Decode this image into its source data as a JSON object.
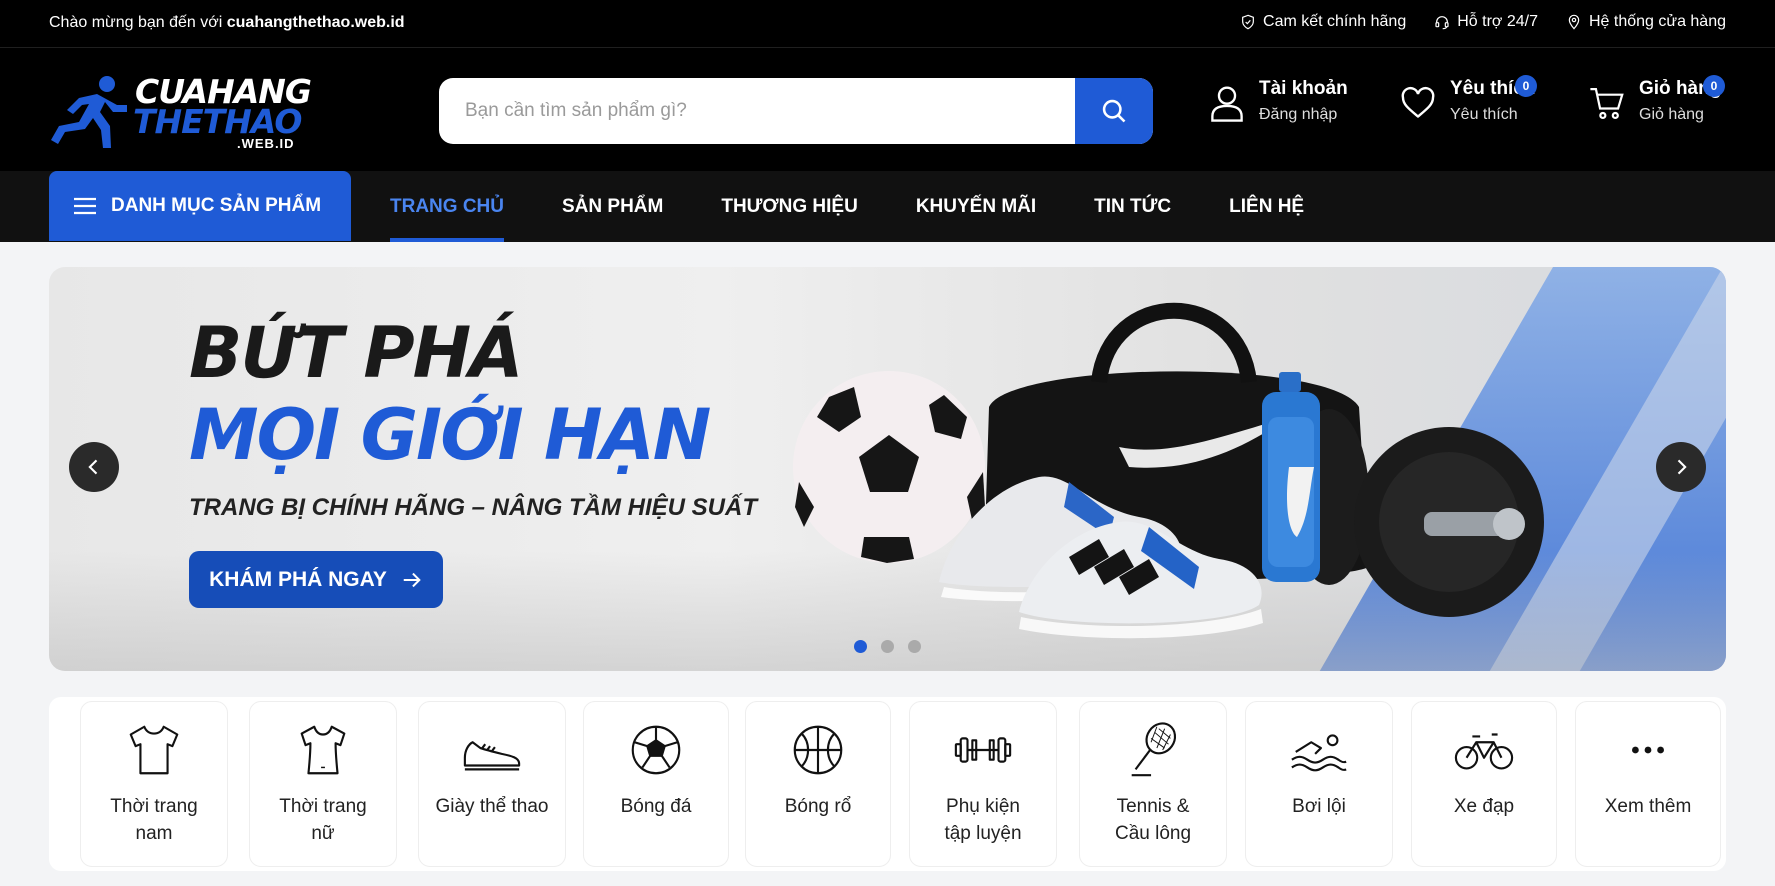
{
  "topbar": {
    "welcome_prefix": "Chào mừng bạn đến với ",
    "welcome_site": "cuahangthethao.web.id",
    "links": [
      {
        "label": "Cam kết chính hãng",
        "icon": "shield-icon"
      },
      {
        "label": "Hỗ trợ 24/7",
        "icon": "headset-icon"
      },
      {
        "label": "Hệ thống cửa hàng",
        "icon": "location-pin-icon"
      }
    ]
  },
  "header": {
    "logo": {
      "line1": "CUAHANG",
      "line2": "THETHAO",
      "line3": ".WEB.ID"
    },
    "search": {
      "placeholder": "Bạn cần tìm sản phẩm gì?",
      "value": ""
    },
    "account": {
      "title": "Tài khoản",
      "subtitle": "Đăng nhập"
    },
    "wishlist": {
      "title": "Yêu thích",
      "subtitle": "Yêu thích",
      "count": "0"
    },
    "cart": {
      "title": "Giỏ hàng",
      "subtitle": "Giỏ hàng",
      "count": "0"
    }
  },
  "nav": {
    "category_button": "DANH MỤC SẢN PHẨM",
    "items": [
      {
        "label": "TRANG CHỦ",
        "active": true
      },
      {
        "label": "SẢN PHẨM",
        "active": false
      },
      {
        "label": "THƯƠNG HIỆU",
        "active": false
      },
      {
        "label": "KHUYẾN MÃI",
        "active": false
      },
      {
        "label": "TIN TỨC",
        "active": false
      },
      {
        "label": "LIÊN HỆ",
        "active": false
      }
    ]
  },
  "banner": {
    "headline1": "BỨT PHÁ",
    "headline2": "MỌI GIỚI HẠN",
    "subtitle": "TRANG BỊ CHÍNH HÃNG – NÂNG TẦM HIỆU SUẤT",
    "cta": "KHÁM PHÁ NGAY",
    "slide_count": 3,
    "active_slide": 1
  },
  "categories": [
    {
      "line1": "Thời trang",
      "line2": "nam",
      "icon": "tshirt-icon"
    },
    {
      "line1": "Thời trang",
      "line2": "nữ",
      "icon": "tshirt-women-icon"
    },
    {
      "line1": "Giày thể thao",
      "line2": "",
      "icon": "sneaker-icon"
    },
    {
      "line1": "Bóng đá",
      "line2": "",
      "icon": "soccer-ball-icon"
    },
    {
      "line1": "Bóng rổ",
      "line2": "",
      "icon": "basketball-icon"
    },
    {
      "line1": "Phụ kiện",
      "line2": "tập luyện",
      "icon": "dumbbell-icon"
    },
    {
      "line1": "Tennis &",
      "line2": "Cầu lông",
      "icon": "racket-icon"
    },
    {
      "line1": "Bơi lội",
      "line2": "",
      "icon": "swimmer-icon"
    },
    {
      "line1": "Xe đạp",
      "line2": "",
      "icon": "bicycle-icon"
    },
    {
      "line1": "Xem thêm",
      "line2": "",
      "icon": "more-dots-icon"
    }
  ],
  "colors": {
    "accent": "#1f5bd6",
    "topbar_bg": "#000000",
    "nav_bg": "#111111",
    "active_nav": "#4a85f0"
  }
}
